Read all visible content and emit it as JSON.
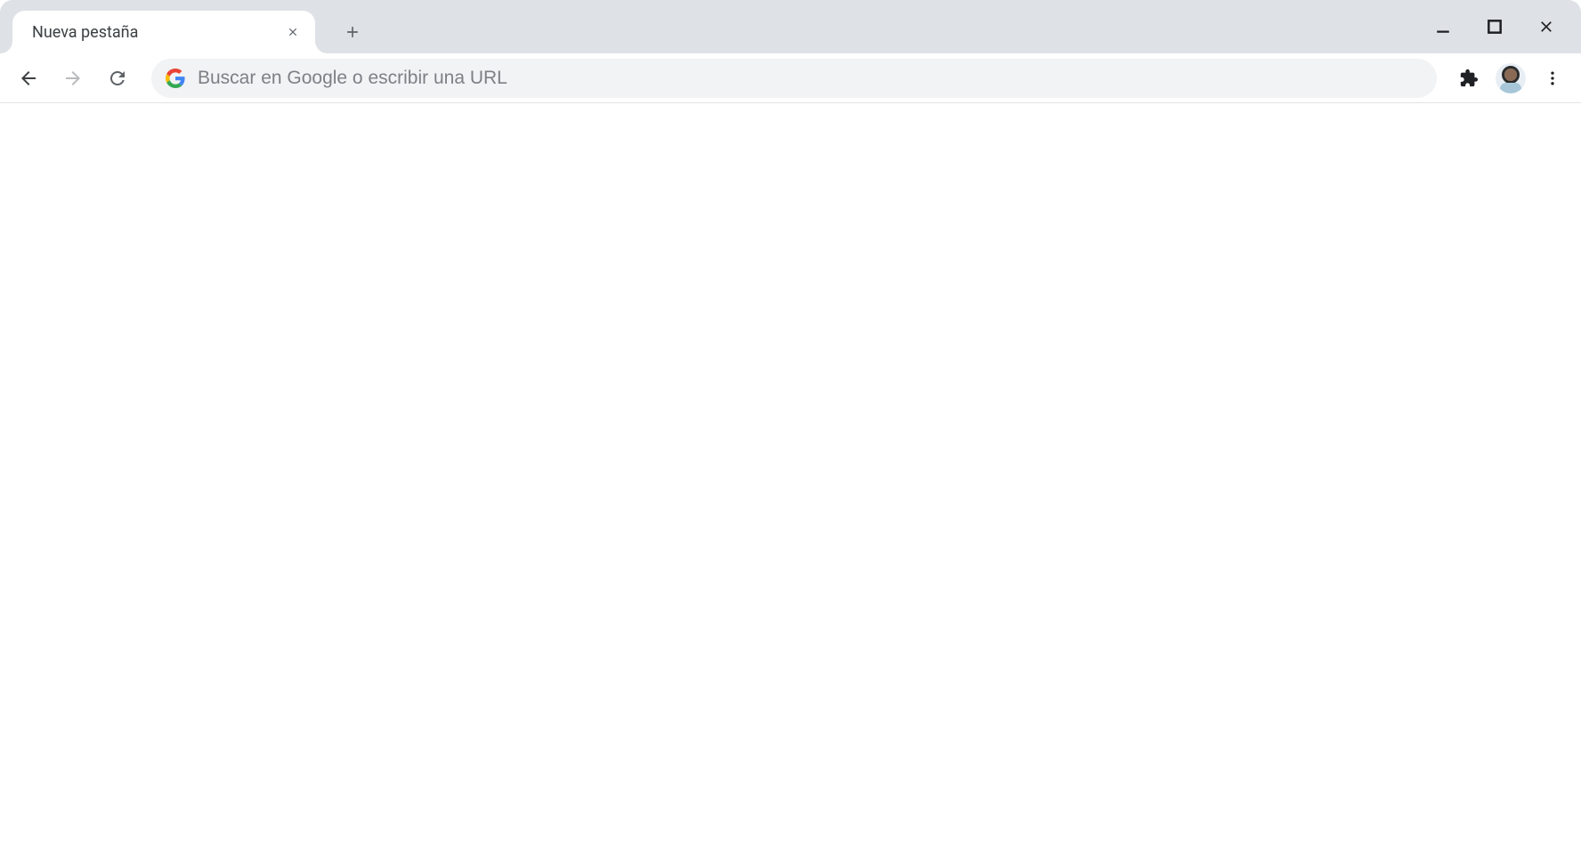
{
  "tabs": [
    {
      "title": "Nueva pestaña",
      "active": true
    }
  ],
  "omnibox": {
    "placeholder": "Buscar en Google o escribir una URL",
    "value": ""
  },
  "icons": {
    "close": "close-icon",
    "new_tab": "plus-icon",
    "minimize": "minimize-icon",
    "maximize": "maximize-icon",
    "window_close": "close-icon",
    "back": "arrow-left-icon",
    "forward": "arrow-right-icon",
    "reload": "reload-icon",
    "search_engine": "google-g-icon",
    "extensions": "puzzle-piece-icon",
    "profile": "avatar-icon",
    "menu": "dots-vertical-icon"
  },
  "nav": {
    "back_enabled": true,
    "forward_enabled": false
  },
  "colors": {
    "tabstrip_bg": "#dee1e6",
    "toolbar_bg": "#ffffff",
    "omnibox_bg": "#f1f3f4",
    "text": "#3c4043",
    "placeholder": "#7d8085",
    "divider": "#e3e3e3"
  }
}
